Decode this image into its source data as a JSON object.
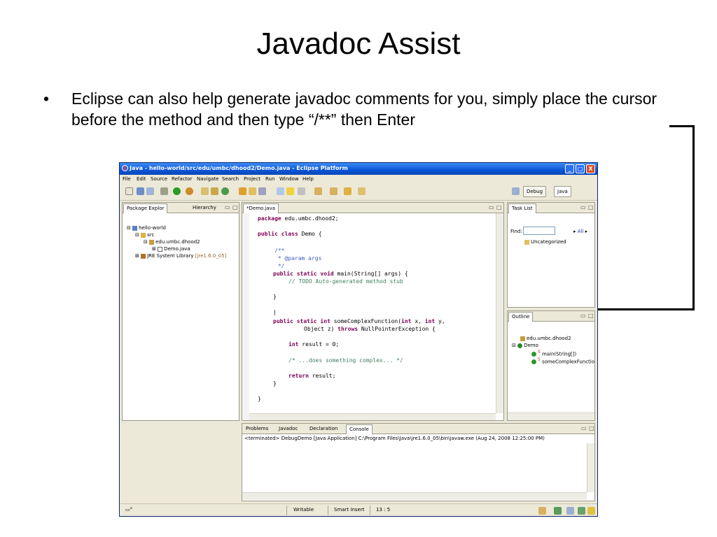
{
  "slide": {
    "title": "Javadoc Assist",
    "bullet_symbol": "•",
    "bullet_text": "Eclipse can also help generate javadoc comments for you, simply place the cursor before the method and then type “/**” then Enter"
  },
  "window": {
    "title": "Java - hello-world/src/edu/umbc/dhood2/Demo.java - Eclipse Platform",
    "minimize": "_",
    "maximize": "□",
    "close": "X"
  },
  "menu": [
    "File",
    "Edit",
    "Source",
    "Refactor",
    "Navigate",
    "Search",
    "Project",
    "Run",
    "Window",
    "Help"
  ],
  "perspectives": {
    "debug": "Debug",
    "java": "Java"
  },
  "package_explorer": {
    "tab": "Package Explor",
    "tab2": "Hierarchy",
    "tree": {
      "project": "hello-world",
      "src": "src",
      "package": "edu.umbc.dhood2",
      "file": "Demo.java",
      "jre": "JRE System Library",
      "jre_version": "[jre1.6.0_05]"
    }
  },
  "editor": {
    "tab": "*Demo.java",
    "lines": {
      "pkg_kw": "package",
      "pkg_name": " edu.umbc.dhood2;",
      "class_kw": "public class",
      "class_name": " Demo {",
      "doc_open": "/**",
      "doc_param": " * @param args",
      "doc_close": " */",
      "main_kw": "public static void",
      "main_sig": " main(String[] args) {",
      "todo": "// TODO Auto-generated method stub",
      "close1": "}",
      "cursor": "|",
      "fn_kw": "public static int",
      "fn_sig1": " someComplexFunction(",
      "fn_int1": "int",
      "fn_x": " x, ",
      "fn_int2": "int",
      "fn_y": " y,",
      "fn_sig2": "Object z) ",
      "fn_throws": "throws",
      "fn_exc": " NullPointerException {",
      "int_kw": "int",
      "result_decl": " result = 0;",
      "complex_cm": "/* ...does something complex... */",
      "return_kw": "return",
      "return_val": " result;",
      "close2": "}",
      "close3": "}"
    }
  },
  "task_list": {
    "tab": "Task List",
    "find_label": "Find:",
    "all_label": "All",
    "category": "Uncategorized"
  },
  "outline": {
    "tab": "Outline",
    "package": "edu.umbc.dhood2",
    "class": "Demo",
    "method1": "main(String[])",
    "method2": "someComplexFunctior",
    "static_marker": "S"
  },
  "console": {
    "tabs": [
      "Problems",
      "Javadoc",
      "Declaration",
      "Console"
    ],
    "line": "<terminated> DebugDemo [Java Application] C:\\Program Files\\Java\\jre1.6.0_05\\bin\\javaw.exe (Aug 24, 2008 12:25:00 PM)"
  },
  "status_bar": {
    "writable": "Writable",
    "insert_mode": "Smart Insert",
    "position": "13 : 5"
  },
  "colors": {
    "keyword": "#7f0055",
    "javadoc": "#3f5fbf",
    "comment": "#3f7f5f",
    "titlebar": "#0a55d8"
  }
}
